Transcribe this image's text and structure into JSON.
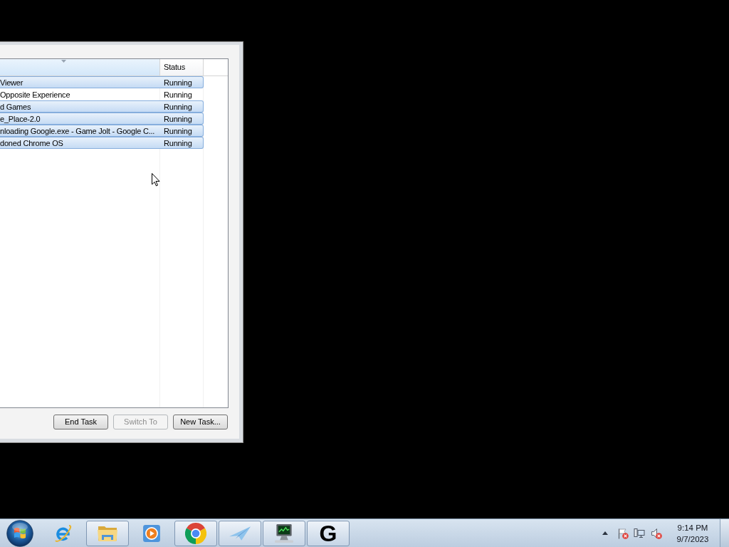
{
  "window": {
    "list": {
      "columns": [
        {
          "sorted": true
        },
        {
          "label": "Status",
          "sorted": false
        }
      ],
      "rows": [
        {
          "task": "Viewer",
          "status": "Running",
          "selected": true
        },
        {
          "task": "Opposite Experience",
          "status": "Running",
          "selected": false
        },
        {
          "task": "d Games",
          "status": "Running",
          "selected": true
        },
        {
          "task": "e_Place-2.0",
          "status": "Running",
          "selected": true
        },
        {
          "task": "nloading Google.exe - Game Jolt - Google C...",
          "status": "Running",
          "selected": true
        },
        {
          "task": "doned Chrome OS",
          "status": "Running",
          "selected": true
        }
      ]
    },
    "buttons": [
      {
        "label": "End Task",
        "disabled": false
      },
      {
        "label": "Switch To",
        "disabled": true
      },
      {
        "label": "New Task...",
        "disabled": false
      }
    ]
  },
  "taskbar": {
    "apps": [
      {
        "kind": "e-logo",
        "running": false
      },
      {
        "kind": "folder",
        "running": true
      },
      {
        "kind": "play",
        "running": false
      },
      {
        "kind": "ring",
        "running": true
      },
      {
        "kind": "plane",
        "running": true
      },
      {
        "kind": "monitor",
        "running": true
      },
      {
        "kind": "letter",
        "label": "G",
        "running": true
      }
    ],
    "tray": [
      {
        "kind": "flag",
        "alert": true
      },
      {
        "kind": "network",
        "alert": false
      },
      {
        "kind": "speaker",
        "alert": true
      }
    ],
    "clock": {
      "time": "9:14 PM",
      "date": "9/7/2023"
    }
  }
}
